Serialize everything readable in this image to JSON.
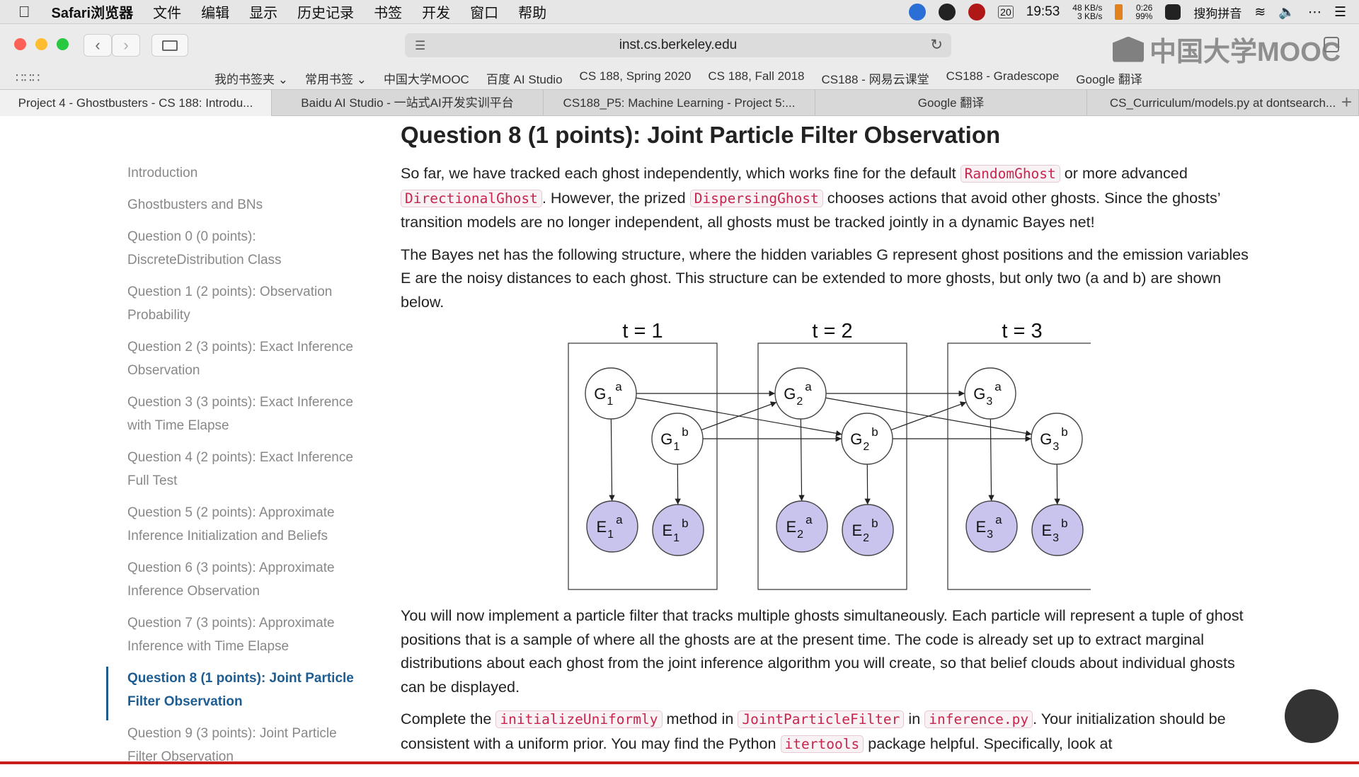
{
  "menubar": {
    "apple": "",
    "app_name": "Safari浏览器",
    "items": [
      "文件",
      "编辑",
      "显示",
      "历史记录",
      "书签",
      "开发",
      "窗口",
      "帮助"
    ],
    "date_badge": "20",
    "clock": "19:53",
    "net_up": "48 KB/s",
    "net_down": "3 KB/s",
    "battery_time": "0:26",
    "battery_pct": "99%",
    "ime": "搜狗拼音"
  },
  "toolbar": {
    "url": "inst.cs.berkeley.edu",
    "watermark": "中国大学MOOC"
  },
  "bookmarks": [
    "我的书签夹 ⌄",
    "常用书签 ⌄",
    "中国大学MOOC",
    "百度 AI Studio",
    "CS 188, Spring 2020",
    "CS 188, Fall 2018",
    "CS188 - 网易云课堂",
    "CS188 - Gradescope",
    "Google 翻译"
  ],
  "tabs": [
    "Project 4 - Ghostbusters - CS 188: Introdu...",
    "Baidu AI Studio - 一站式AI开发实训平台",
    "CS188_P5: Machine Learning - Project 5:...",
    "Google 翻译",
    "CS_Curriculum/models.py at dontsearch..."
  ],
  "sidebar": [
    "Introduction",
    "Ghostbusters and BNs",
    "Question 0 (0 points): DiscreteDistribution Class",
    "Question 1 (2 points): Observation Probability",
    "Question 2 (3 points): Exact Inference Observation",
    "Question 3 (3 points): Exact Inference with Time Elapse",
    "Question 4 (2 points): Exact Inference Full Test",
    "Question 5 (2 points): Approximate Inference Initialization and Beliefs",
    "Question 6 (3 points): Approximate Inference Observation",
    "Question 7 (3 points): Approximate Inference with Time Elapse",
    "Question 8 (1 points): Joint Particle Filter Observation",
    "Question 9 (3 points): Joint Particle Filter Observation"
  ],
  "content": {
    "title": "Question 8 (1 points): Joint Particle Filter Observation",
    "p1": {
      "t1": "So far, we have tracked each ghost independently, which works fine for the default ",
      "c1": "RandomGhost",
      "t2": " or more advanced ",
      "c2": "DirectionalGhost",
      "t3": ". However, the prized ",
      "c3": "DispersingGhost",
      "t4": " chooses actions that avoid other ghosts. Since the ghosts’ transition models are no longer independent, all ghosts must be tracked jointly in a dynamic Bayes net!"
    },
    "p2": "The Bayes net has the following structure, where the hidden variables G represent ghost positions and the emission variables E are the noisy distances to each ghost. This structure can be extended to more ghosts, but only two (a and b) are shown below.",
    "p3": "You will now implement a particle filter that tracks multiple ghosts simultaneously. Each particle will represent a tuple of ghost positions that is a sample of where all the ghosts are at the present time. The code is already set up to extract marginal distributions about each ghost from the joint inference algorithm you will create, so that belief clouds about individual ghosts can be displayed.",
    "p4": {
      "t1": "Complete the ",
      "c1": "initializeUniformly",
      "t2": " method in ",
      "c2": "JointParticleFilter",
      "t3": " in ",
      "c3": "inference.py",
      "t4": ". Your initialization should be consistent with a uniform prior. You may find the Python ",
      "c4": "itertools",
      "t5": " package helpful. Specifically, look at"
    }
  },
  "diagram": {
    "slices": [
      {
        "label": "t = 1",
        "t": "1"
      },
      {
        "label": "t = 2",
        "t": "2"
      },
      {
        "label": "t = 3",
        "t": "3"
      }
    ],
    "hidden": "G",
    "evidence": "E",
    "ghosts": [
      "a",
      "b"
    ],
    "hidden_color": "#ffffff",
    "evidence_color": "#c8c4ee"
  }
}
